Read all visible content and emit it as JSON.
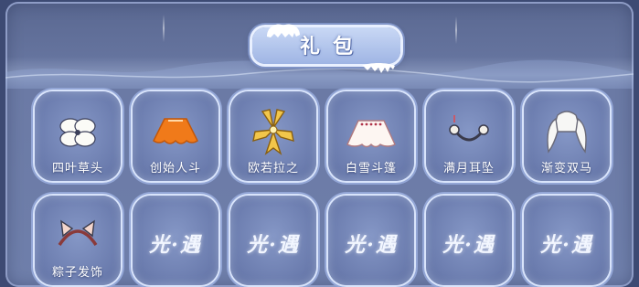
{
  "header": {
    "title": "礼包"
  },
  "items": [
    {
      "label": "四叶草头",
      "icon": "four-leaf-clover-icon"
    },
    {
      "label": "创始人斗",
      "icon": "orange-cape-icon"
    },
    {
      "label": "欧若拉之",
      "icon": "golden-bow-icon"
    },
    {
      "label": "白雪斗篷",
      "icon": "white-cape-icon"
    },
    {
      "label": "满月耳坠",
      "icon": "moon-earring-icon"
    },
    {
      "label": "渐变双马",
      "icon": "twin-ponytail-hair-icon"
    },
    {
      "label": "粽子发饰",
      "icon": "cat-ear-headband-icon"
    }
  ],
  "locked_slots": [
    {
      "logo": "光·遇"
    },
    {
      "logo": "光·遇"
    },
    {
      "logo": "光·遇"
    },
    {
      "logo": "光·遇"
    },
    {
      "logo": "光·遇"
    }
  ]
}
